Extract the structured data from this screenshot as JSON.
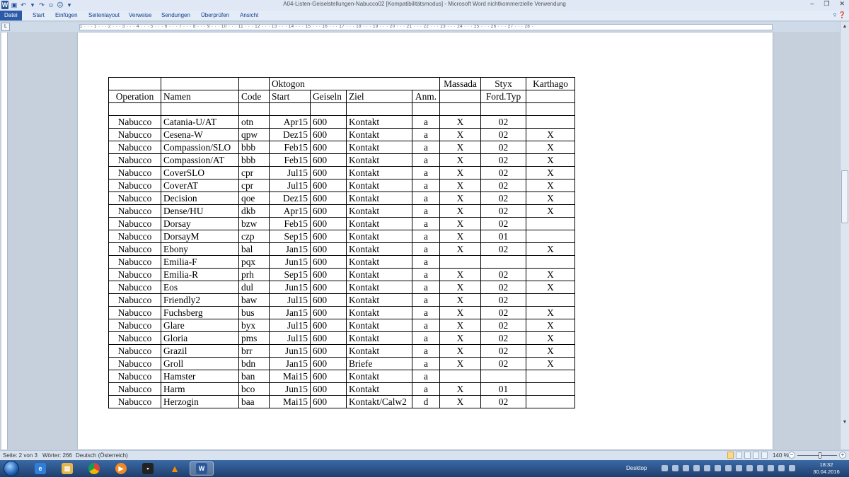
{
  "window": {
    "title": "A04-Listen-Geiselstellungen-Nabucco02 [Kompatibilitätsmodus]  -  Microsoft Word nichtkommerzielle Verwendung"
  },
  "ribbon": {
    "tabs": [
      "Datei",
      "Start",
      "Einfügen",
      "Seitenlayout",
      "Verweise",
      "Sendungen",
      "Überprüfen",
      "Ansicht"
    ]
  },
  "ruler": {
    "text": "1 · · · 1 · · · 2 · · · 3 · · · 4 · · · 5 · · · 6 · · · 7 · · · 8 · · · 9 · · · 10 · · · 11 · · · 12 · · · 13 · · · 14 · · · 15 · · · 16 · · · 17 · · · 18 · · · 19 · · · 20 · · · 21 · · · 22 · · · 23 · · · 24 · · · 25 · · · 26 · · · 27 · · · 28 ·"
  },
  "table": {
    "group_header": {
      "oktogon": "Oktogon",
      "massada": "Massada",
      "styx": "Styx",
      "karthago": "Karthago"
    },
    "columns": {
      "operation": "Operation",
      "namen": "Namen",
      "code": "Code",
      "start": "Start",
      "geiseln": "Geiseln",
      "ziel": "Ziel",
      "anm": "Anm.",
      "massada": "",
      "styx": "Ford.Typ",
      "karthago": ""
    },
    "rows": [
      [
        "Nabucco",
        "Catania-U/AT",
        "otn",
        "Apr15",
        "600",
        "Kontakt",
        "a",
        "X",
        "02",
        ""
      ],
      [
        "Nabucco",
        "Cesena-W",
        "qpw",
        "Dez15",
        "600",
        "Kontakt",
        "a",
        "X",
        "02",
        "X"
      ],
      [
        "Nabucco",
        "Compassion/SLO",
        "bbb",
        "Feb15",
        "600",
        "Kontakt",
        "a",
        "X",
        "02",
        "X"
      ],
      [
        "Nabucco",
        "Compassion/AT",
        "bbb",
        "Feb15",
        "600",
        "Kontakt",
        "a",
        "X",
        "02",
        "X"
      ],
      [
        "Nabucco",
        "CoverSLO",
        "cpr",
        "Jul15",
        "600",
        "Kontakt",
        "a",
        "X",
        "02",
        "X"
      ],
      [
        "Nabucco",
        "CoverAT",
        "cpr",
        "Jul15",
        "600",
        "Kontakt",
        "a",
        "X",
        "02",
        "X"
      ],
      [
        "Nabucco",
        "Decision",
        "qoe",
        "Dez15",
        "600",
        "Kontakt",
        "a",
        "X",
        "02",
        "X"
      ],
      [
        "Nabucco",
        "Dense/HU",
        "dkb",
        "Apr15",
        "600",
        "Kontakt",
        "a",
        "X",
        "02",
        "X"
      ],
      [
        "Nabucco",
        "Dorsay",
        "bzw",
        "Feb15",
        "600",
        "Kontakt",
        "a",
        "X",
        "02",
        ""
      ],
      [
        "Nabucco",
        "DorsayM",
        "czp",
        "Sep15",
        "600",
        "Kontakt",
        "a",
        "X",
        "01",
        ""
      ],
      [
        "Nabucco",
        "Ebony",
        "bal",
        "Jan15",
        "600",
        "Kontakt",
        "a",
        "X",
        "02",
        "X"
      ],
      [
        "Nabucco",
        "Emilia-F",
        "pqx",
        "Jun15",
        "600",
        "Kontakt",
        "a",
        "",
        "",
        ""
      ],
      [
        "Nabucco",
        "Emilia-R",
        "prh",
        "Sep15",
        "600",
        "Kontakt",
        "a",
        "X",
        "02",
        "X"
      ],
      [
        "Nabucco",
        "Eos",
        "dul",
        "Jun15",
        "600",
        "Kontakt",
        "a",
        "X",
        "02",
        "X"
      ],
      [
        "Nabucco",
        "Friendly2",
        "baw",
        "Jul15",
        "600",
        "Kontakt",
        "a",
        "X",
        "02",
        ""
      ],
      [
        "Nabucco",
        "Fuchsberg",
        "bus",
        "Jan15",
        "600",
        "Kontakt",
        "a",
        "X",
        "02",
        "X"
      ],
      [
        "Nabucco",
        "Glare",
        "byx",
        "Jul15",
        "600",
        "Kontakt",
        "a",
        "X",
        "02",
        "X"
      ],
      [
        "Nabucco",
        "Gloria",
        "pms",
        "Jul15",
        "600",
        "Kontakt",
        "a",
        "X",
        "02",
        "X"
      ],
      [
        "Nabucco",
        "Grazil",
        "brr",
        "Jun15",
        "600",
        "Kontakt",
        "a",
        "X",
        "02",
        "X"
      ],
      [
        "Nabucco",
        "Groll",
        "bdn",
        "Jan15",
        "600",
        "Briefe",
        "a",
        "X",
        "02",
        "X"
      ],
      [
        "Nabucco",
        "Hamster",
        "ban",
        "Mai15",
        "600",
        "Kontakt",
        "a",
        "",
        "",
        ""
      ],
      [
        "Nabucco",
        "Harm",
        "bco",
        "Jun15",
        "600",
        "Kontakt",
        "a",
        "X",
        "01",
        ""
      ],
      [
        "Nabucco",
        "Herzogin",
        "baa",
        "Mai15",
        "600",
        "Kontakt/Calw2",
        "d",
        "X",
        "02",
        ""
      ]
    ]
  },
  "statusbar": {
    "page": "Seite: 2 von 3",
    "words": "Wörter: 266",
    "language": "Deutsch (Österreich)",
    "zoom": "140 %"
  },
  "taskbar": {
    "desktop_label": "Desktop",
    "time": "18:32",
    "date": "30.04.2016",
    "apps": [
      "internet-explorer",
      "file-explorer",
      "chrome",
      "media-player",
      "app-dark",
      "vlc",
      "word"
    ]
  }
}
